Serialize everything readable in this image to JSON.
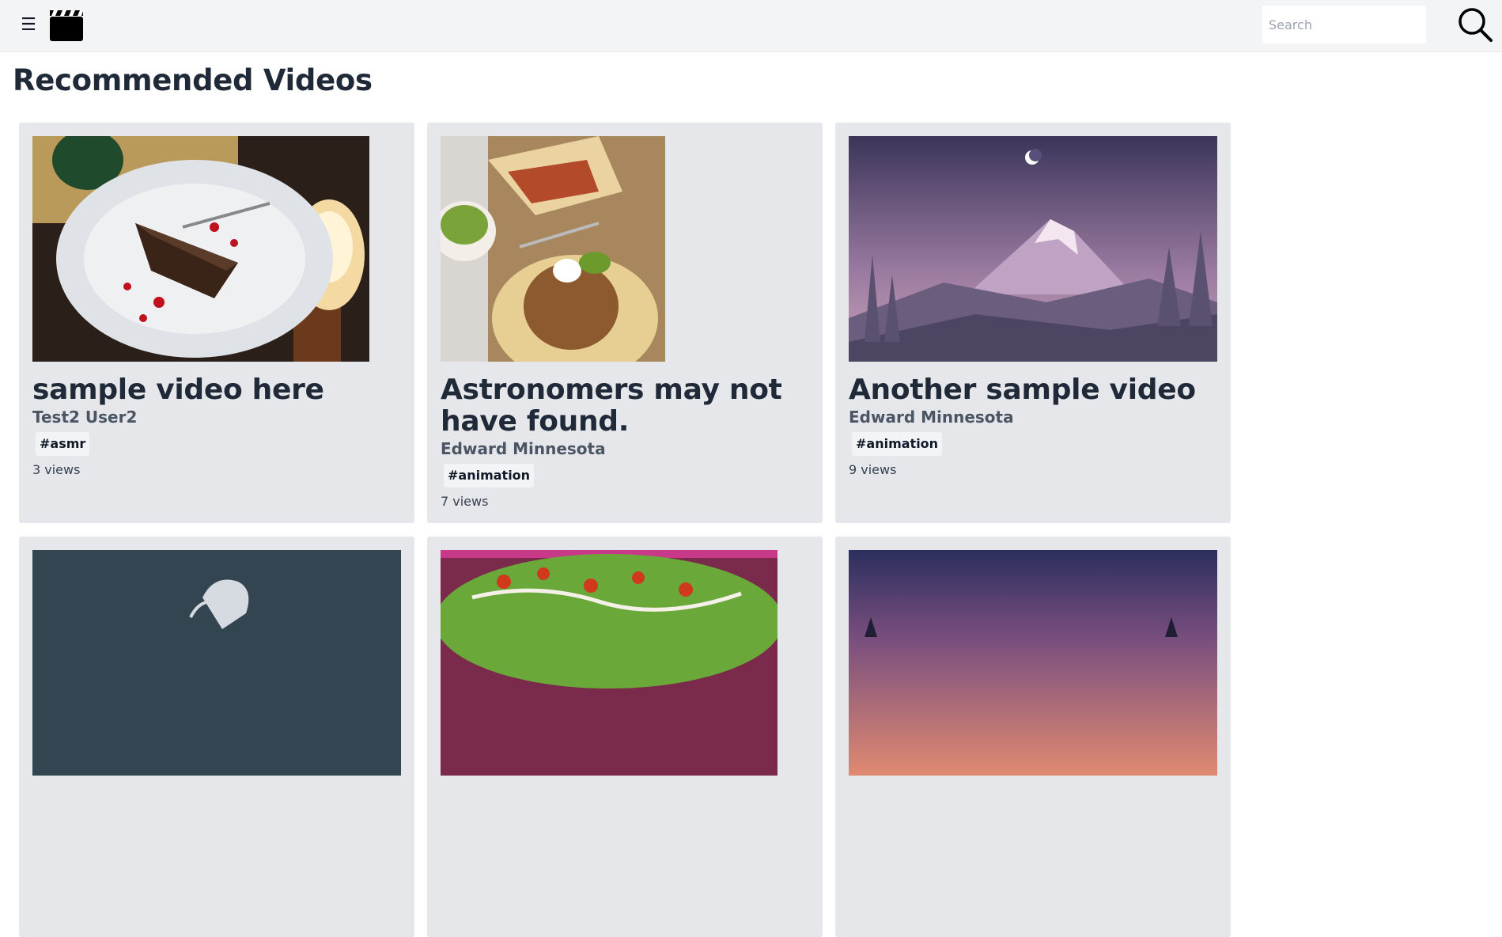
{
  "header": {
    "menu_icon": "menu-icon",
    "logo_icon": "clapperboard-icon",
    "search": {
      "placeholder": "Search",
      "value": ""
    },
    "search_icon": "search-icon"
  },
  "main": {
    "title": "Recommended Videos",
    "videos": [
      {
        "title": "sample video here",
        "author": "Test2 User2",
        "tag": "#asmr",
        "views": "3 views",
        "thumbnail": "chocolate cake on plate"
      },
      {
        "title": "Astronomers may not have found.",
        "author": "Edward Minnesota",
        "tag": "#animation",
        "views": "7 views",
        "thumbnail": "tacos"
      },
      {
        "title": "Another sample video",
        "author": "Edward Minnesota",
        "tag": "#animation",
        "views": "9 views",
        "thumbnail": "purple mountain landscape"
      },
      {
        "thumbnail": "dark slate illustration"
      },
      {
        "thumbnail": "nachos"
      },
      {
        "thumbnail": "dusk forest silhouette"
      }
    ]
  },
  "colors": {
    "topbar_bg": "#f3f4f6",
    "card_bg": "#e5e7eb",
    "text_primary": "#1f2937",
    "text_secondary": "#4b5563"
  }
}
